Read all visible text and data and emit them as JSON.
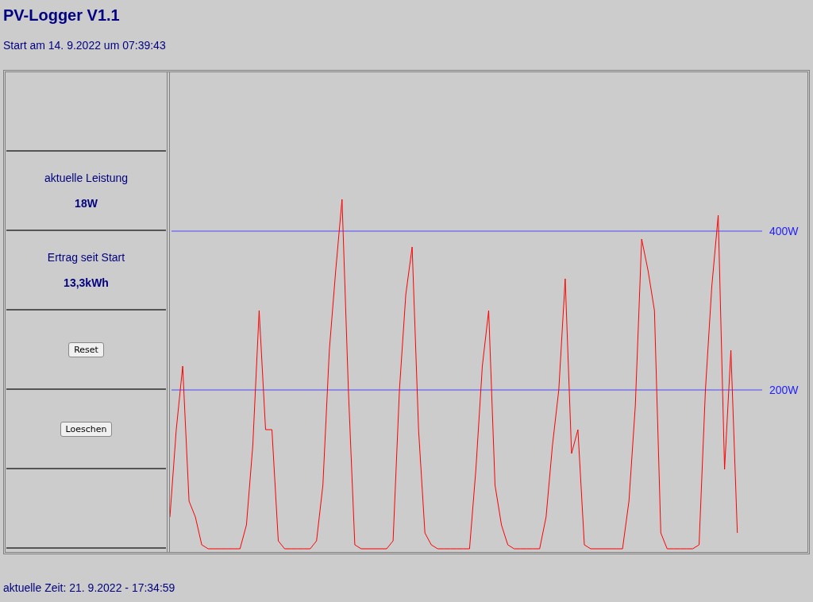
{
  "title": "PV-Logger V1.1",
  "start": "Start am 14. 9.2022 um 07:39:43",
  "panel": [
    {
      "kind": "reading",
      "label": "aktuelle Leistung",
      "value": "18W"
    },
    {
      "kind": "reading",
      "label": "Ertrag seit Start",
      "value": "13,3kWh"
    },
    {
      "kind": "button",
      "label": "Reset"
    },
    {
      "kind": "button",
      "label": "Loeschen"
    }
  ],
  "chart": {
    "reference_lines": [
      {
        "label": "400W"
      },
      {
        "label": "200W"
      }
    ]
  },
  "footer": "aktuelle Zeit: 21. 9.2022 - 17:34:59"
}
